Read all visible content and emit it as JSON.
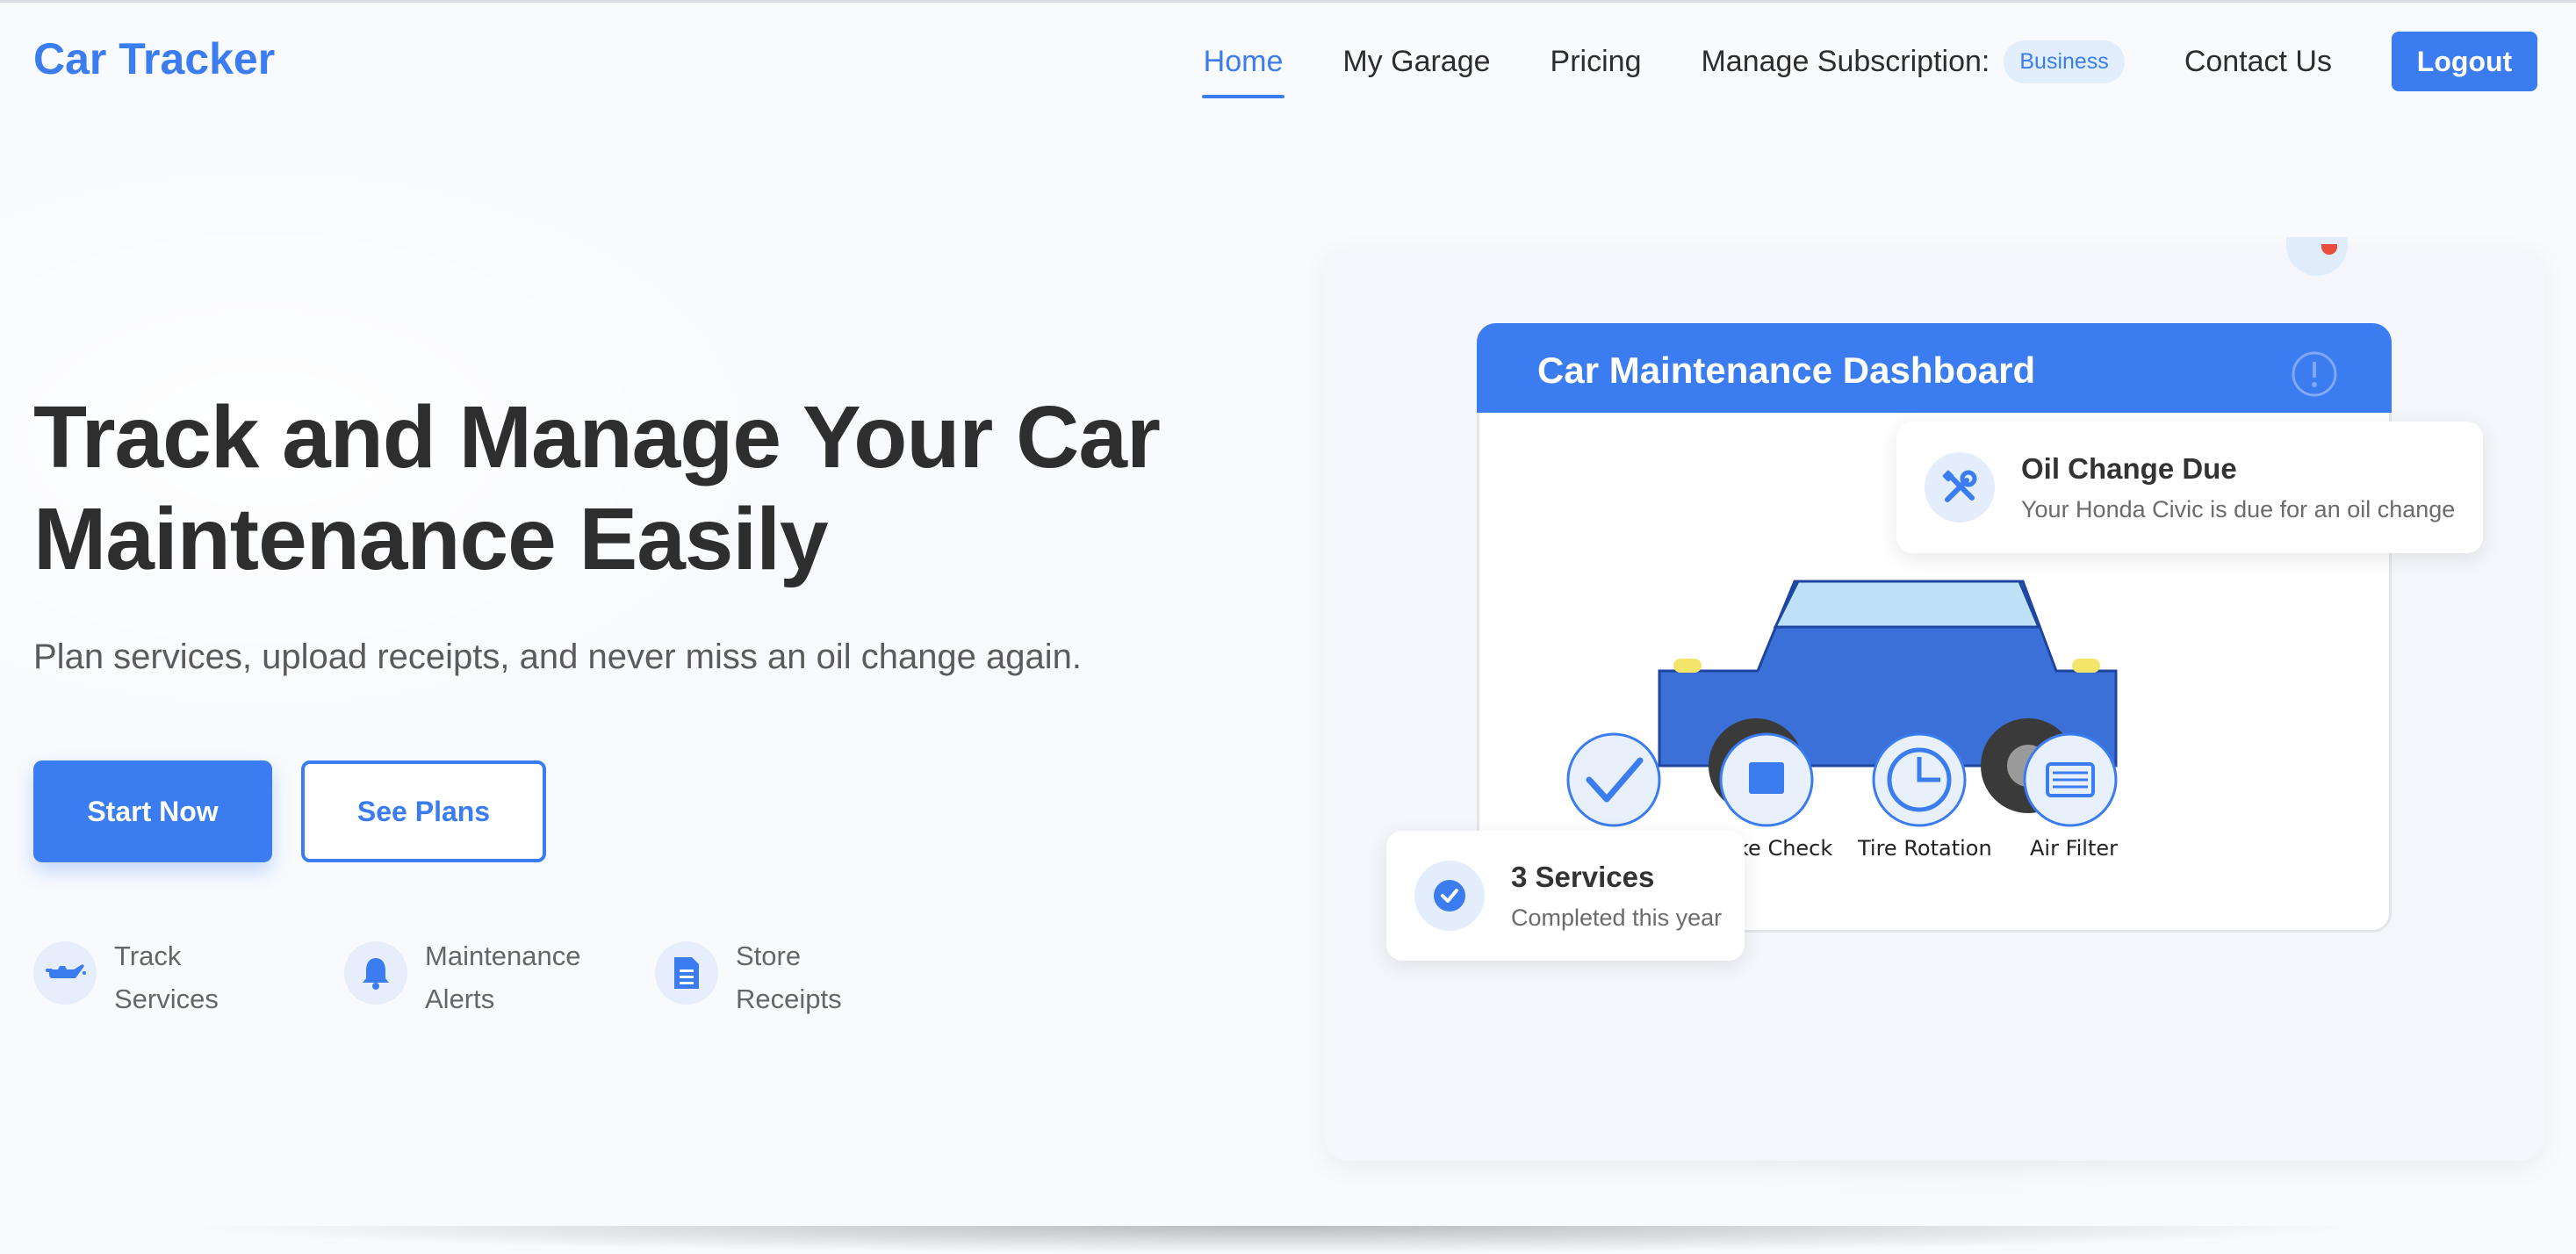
{
  "nav": {
    "brand": "Car Tracker",
    "links": [
      "Home",
      "My Garage",
      "Pricing"
    ],
    "subscription_label": "Manage Subscription:",
    "subscription_badge": "Business",
    "contact": "Contact Us",
    "logout": "Logout",
    "active": "Home"
  },
  "hero": {
    "title": "Track and Manage Your Car Maintenance Easily",
    "subtitle": "Plan services, upload receipts, and never miss an oil change again.",
    "primary_button": "Start Now",
    "secondary_button": "See Plans",
    "features": [
      {
        "icon": "oil-can-icon",
        "label": "Track Services"
      },
      {
        "icon": "bell-icon",
        "label": "Maintenance Alerts"
      },
      {
        "icon": "receipt-icon",
        "label": "Store Receipts"
      }
    ]
  },
  "dashboard": {
    "title": "Car Maintenance Dashboard",
    "services": [
      {
        "icon": "checkmark-icon",
        "label": ""
      },
      {
        "icon": "brake-icon",
        "label": "ke Check"
      },
      {
        "icon": "clock-icon",
        "label": "Tire Rotation"
      },
      {
        "icon": "filter-icon",
        "label": "Air Filter"
      }
    ],
    "alert_card": {
      "title": "Oil Change Due",
      "desc": "Your Honda Civic is due for an oil change",
      "icon": "tools-icon"
    },
    "summary_card": {
      "title": "3 Services",
      "desc": "Completed this year",
      "icon": "check-circle-icon"
    }
  },
  "colors": {
    "accent": "#3b7cf0",
    "car_body": "#3b70d8",
    "car_window": "#bfe1f7",
    "headlight": "#f5e46a"
  }
}
